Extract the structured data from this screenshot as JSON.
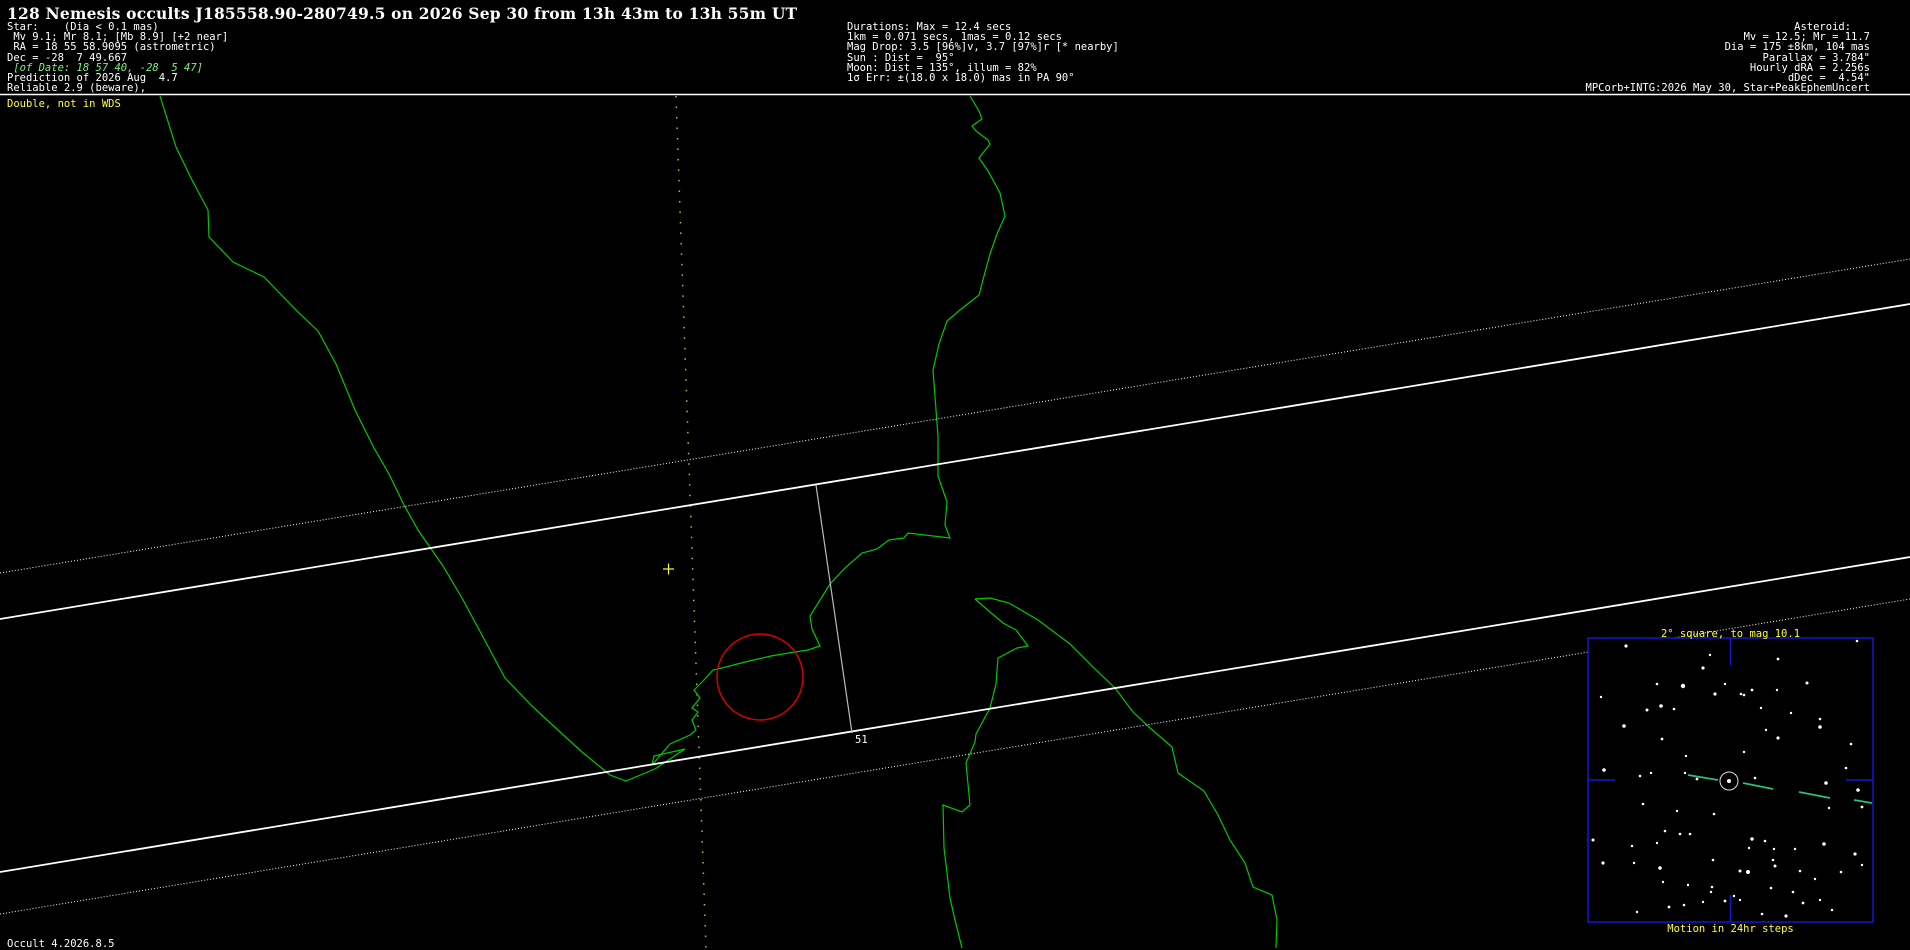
{
  "title": "128 Nemesis occults J185558.90-280749.5 on 2026 Sep 30 from 13h 43m to 13h 55m UT",
  "star_block": [
    {
      "text": "Star:    (Dia < 0.1 mas)",
      "style": "white"
    },
    {
      "text": " Mv 9.1; Mr 8.1; [Mb 8.9] [+2 near]",
      "style": "white"
    },
    {
      "text": " RA = 18 55 58.9095 (astrometric)",
      "style": "white"
    },
    {
      "text": "Dec = -28  7 49.667",
      "style": "white"
    },
    {
      "text": " [of Date: 18 57 40, -28  5 47]",
      "style": "green"
    },
    {
      "text": "Prediction of 2026 Aug  4.7",
      "style": "white"
    },
    {
      "text": "Reliable 2.9 (beware),",
      "style": "white"
    }
  ],
  "durations_block": [
    "Durations: Max = 12.4 secs",
    "1km = 0.071 secs, 1mas = 0.12 secs",
    "Mag Drop: 3.5 [96%]v, 3.7 [97%]r [* nearby]",
    "Sun : Dist =  95°",
    "Moon: Dist = 135°, illum = 82%",
    "1σ Err: ±(18.0 x 18.0) mas in PA 90°"
  ],
  "asteroid_block": [
    "Asteroid:   ",
    "Mv = 12.5; Mr = 11.7",
    "Dia = 175 ±8km, 104 mas",
    "Parallax = 3.784\"",
    "Hourly dRA = 2.256s",
    "dDec =  4.54\"",
    "MPCorb+INTG:2026 May 30, Star+PeakEphemUncert"
  ],
  "double_note": "Double, not in WDS",
  "version": "Occult 4.2026.8.5",
  "path_label": "51",
  "finder": {
    "title": "2° square, to mag 10.1",
    "caption": "Motion in 24hr steps"
  },
  "colors": {
    "coastline": "#00c800",
    "path_line": "#ffffff",
    "center_marker": "#d40000",
    "finder_border": "#1616d4",
    "label_yellow": "#ffff33",
    "motion_track": "#2fbf7a"
  }
}
